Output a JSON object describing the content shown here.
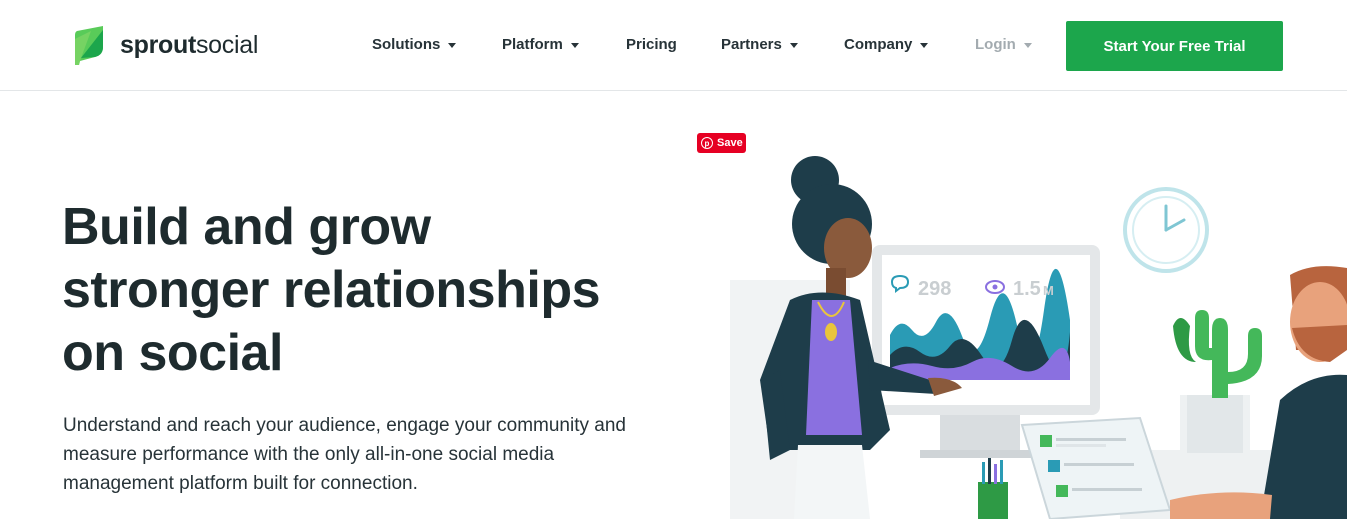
{
  "brand": {
    "name_bold": "sprout",
    "name_light": "social",
    "accent": "#1ca64c"
  },
  "nav": {
    "items": [
      {
        "label": "Solutions",
        "has_caret": true
      },
      {
        "label": "Platform",
        "has_caret": true
      },
      {
        "label": "Pricing",
        "has_caret": false
      },
      {
        "label": "Partners",
        "has_caret": true
      },
      {
        "label": "Company",
        "has_caret": true
      },
      {
        "label": "Login",
        "has_caret": true
      }
    ],
    "cta_label": "Start Your Free Trial"
  },
  "hero": {
    "title_lines": [
      "Build and grow",
      "stronger relationships",
      "on social"
    ],
    "subtitle": "Understand and reach your audience, engage your community and measure performance with the only all-in-one social media management platform built for connection."
  },
  "pinterest": {
    "save_label": "Save",
    "color": "#e60023"
  },
  "illustration": {
    "stat_comments": "298",
    "stat_views": "1.5",
    "stat_views_unit": "M",
    "icons": [
      "comment-icon",
      "eye-icon",
      "clock-icon",
      "pencil-cup-icon",
      "cactus-icon"
    ]
  }
}
